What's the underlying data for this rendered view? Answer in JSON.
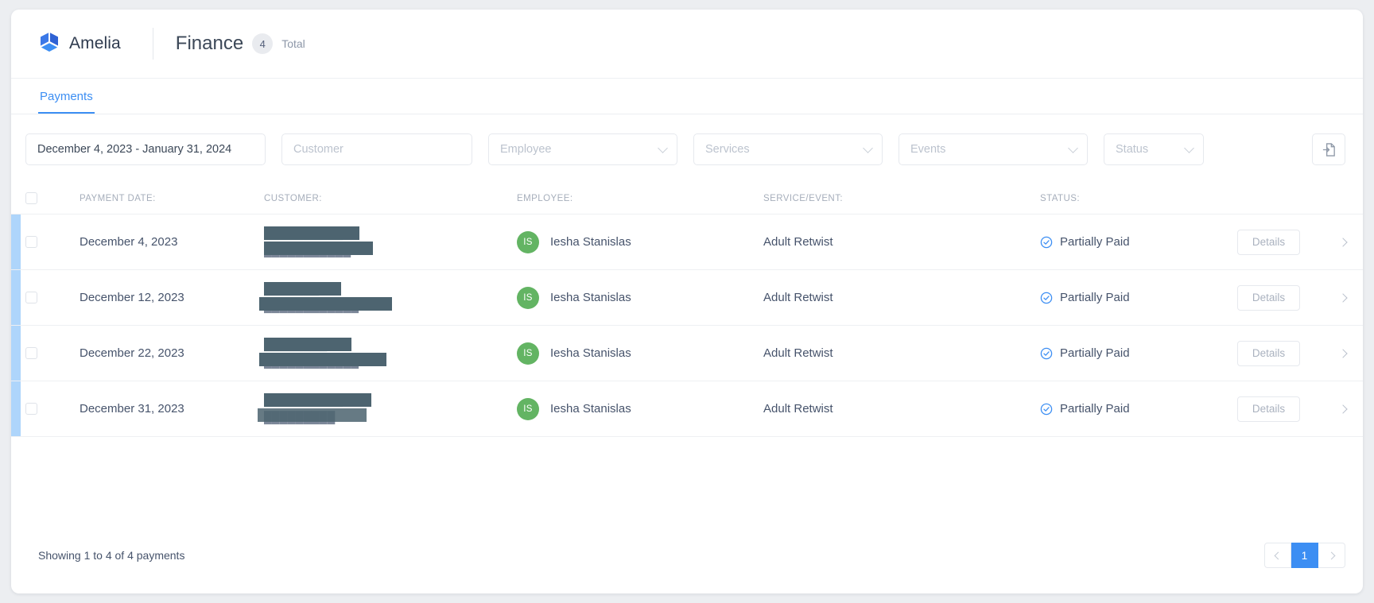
{
  "header": {
    "brand_name": "Amelia",
    "logo_icon": "amelia-cube-logo",
    "page_title": "Finance",
    "count": "4",
    "count_label": "Total"
  },
  "tabs": [
    {
      "label": "Payments",
      "active": true
    }
  ],
  "filters": {
    "date_range_value": "December 4, 2023 - January 31, 2024",
    "customer_placeholder": "Customer",
    "employee_placeholder": "Employee",
    "services_placeholder": "Services",
    "events_placeholder": "Events",
    "status_placeholder": "Status",
    "export_icon": "export-document-icon"
  },
  "table": {
    "headers": {
      "payment_date": "PAYMENT DATE:",
      "customer": "CUSTOMER:",
      "employee": "EMPLOYEE:",
      "service_event": "SERVICE/EVENT:",
      "status": "STATUS:"
    },
    "details_label": "Details",
    "rows": [
      {
        "date": "December 4, 2023",
        "customer_redacted": true,
        "customer_line1": "██████████",
        "customer_line2": "███████████",
        "employee": "Iesha Stanislas",
        "employee_initials": "IS",
        "service": "Adult Retwist",
        "status": "Partially Paid",
        "status_icon": "partially-paid-check-icon"
      },
      {
        "date": "December 12, 2023",
        "customer_redacted": true,
        "customer_line1": "███████",
        "customer_line2": "████████████",
        "employee": "Iesha Stanislas",
        "employee_initials": "IS",
        "service": "Adult Retwist",
        "status": "Partially Paid",
        "status_icon": "partially-paid-check-icon"
      },
      {
        "date": "December 22, 2023",
        "customer_redacted": true,
        "customer_line1": "████████",
        "customer_line2": "████████████",
        "employee": "Iesha Stanislas",
        "employee_initials": "IS",
        "service": "Adult Retwist",
        "status": "Partially Paid",
        "status_icon": "partially-paid-check-icon"
      },
      {
        "date": "December 31, 2023",
        "customer_redacted": true,
        "customer_line1": "██████████",
        "customer_line2": "█████████",
        "employee": "Iesha Stanislas",
        "employee_initials": "IS",
        "service": "Adult Retwist",
        "status": "Partially Paid",
        "status_icon": "partially-paid-check-icon"
      }
    ]
  },
  "footer": {
    "showing_text": "Showing 1 to 4 of 4 payments",
    "current_page": "1"
  },
  "colors": {
    "accent_blue": "#3c8ef3",
    "row_accent": "#aed5fb",
    "avatar_green": "#63b463",
    "redaction": "#4d6470",
    "text_primary": "#46536b",
    "text_muted": "#a6aebb"
  }
}
